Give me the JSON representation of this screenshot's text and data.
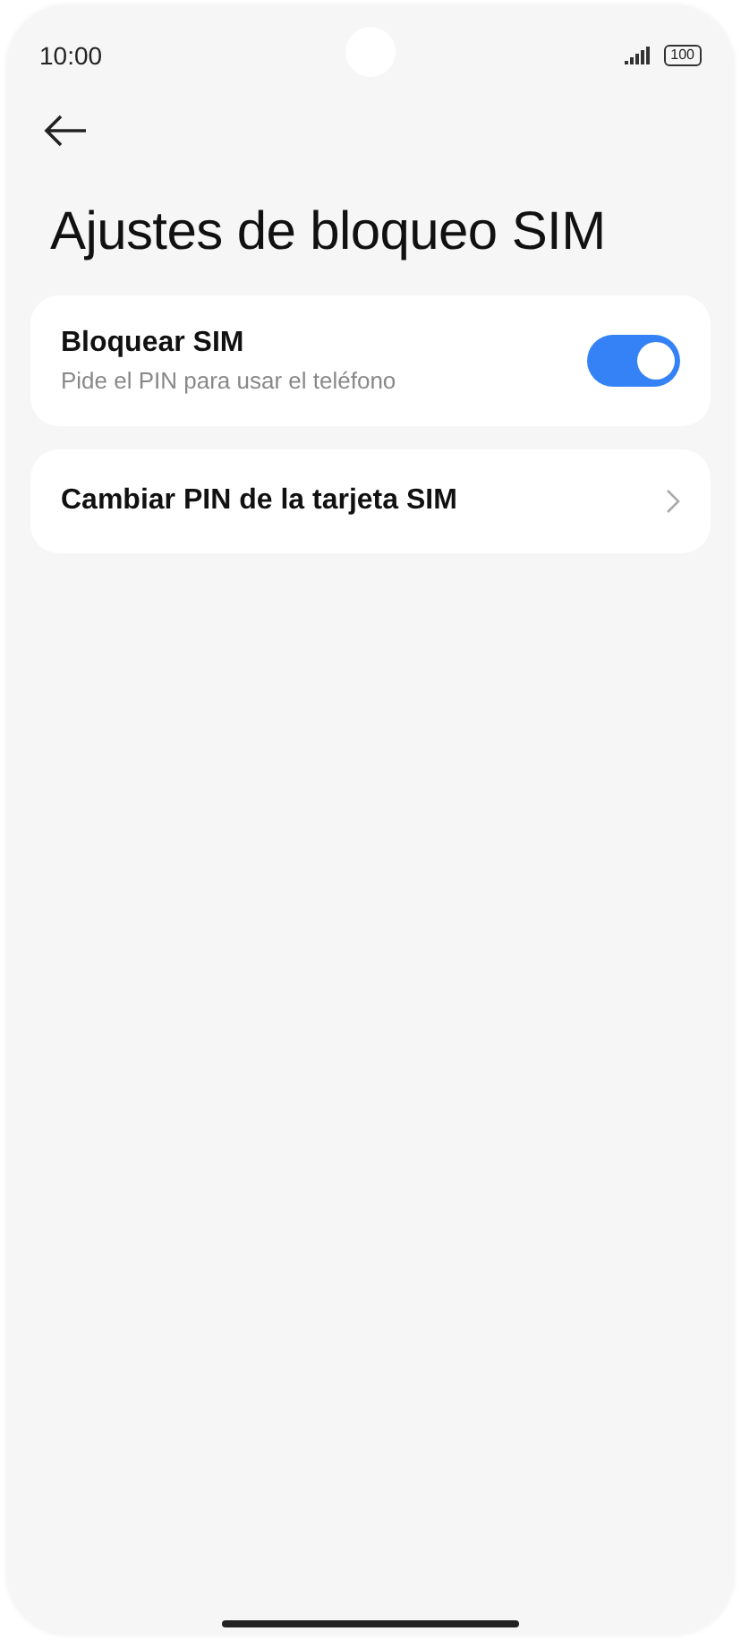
{
  "status_bar": {
    "time": "10:00",
    "battery": "100"
  },
  "title": "Ajustes de bloqueo SIM",
  "items": [
    {
      "kind": "toggle",
      "label": "Bloquear SIM",
      "subtitle": "Pide el PIN para usar el teléfono",
      "on": true
    },
    {
      "kind": "link",
      "label": "Cambiar PIN de la tarjeta SIM"
    }
  ]
}
